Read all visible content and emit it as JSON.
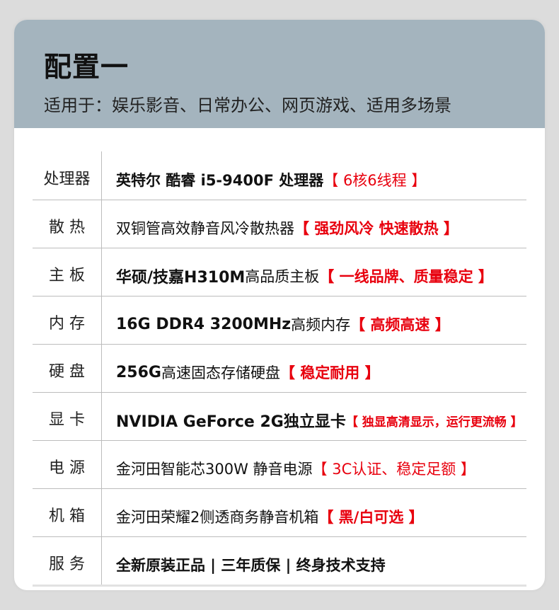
{
  "header": {
    "title": "配置一",
    "subtitle": "适用于：娱乐影音、日常办公、网页游戏、适用多场景"
  },
  "rows": [
    {
      "label": "处理器",
      "main": "英特尔  酷睿 i5-9400F 处理器",
      "tag": "【 6核6线程 】"
    },
    {
      "label": "散  热",
      "main": "双铜管高效静音风冷散热器",
      "tag": "【 强劲风冷 快速散热 】"
    },
    {
      "label": "主  板",
      "main_bold": "华硕/技嘉H310M",
      "main": " 高品质主板",
      "tag": "【 一线品牌、质量稳定 】"
    },
    {
      "label": "内  存",
      "main_bold": "16G DDR4 3200MHz",
      "main": "高频内存",
      "tag": "【 高频高速 】"
    },
    {
      "label": "硬  盘",
      "main_bold": "256G",
      "main": " 高速固态存储硬盘",
      "tag": "【 稳定耐用 】"
    },
    {
      "label": "显  卡",
      "main": "NVIDIA GeForce 2G独立显卡",
      "tag": "【 独显高清显示，运行更流畅 】"
    },
    {
      "label": "电  源",
      "main": "金河田智能芯300W 静音电源",
      "tag": "【 3C认证、稳定足额 】"
    },
    {
      "label": "机  箱",
      "main": "金河田荣耀2侧透商务静音机箱",
      "tag": "【 黑/白可选 】"
    },
    {
      "label": "服  务",
      "main": "全新原装正品 | 三年质保 | 终身技术支持"
    }
  ]
}
